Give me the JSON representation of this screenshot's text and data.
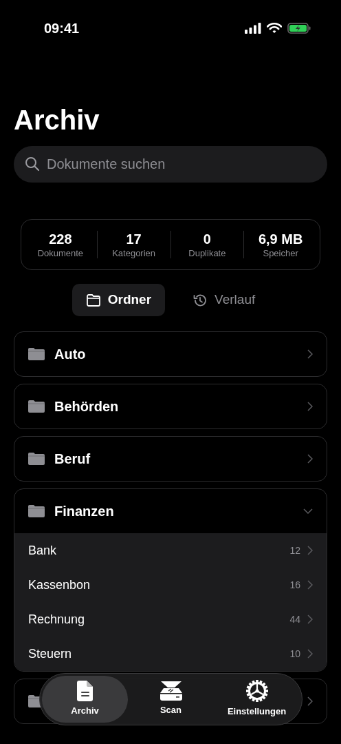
{
  "status_bar": {
    "time": "09:41"
  },
  "title": "Archiv",
  "search": {
    "placeholder": "Dokumente suchen"
  },
  "stats": [
    {
      "value": "228",
      "label": "Dokumente"
    },
    {
      "value": "17",
      "label": "Kategorien"
    },
    {
      "value": "0",
      "label": "Duplikate"
    },
    {
      "value": "6,9 MB",
      "label": "Speicher"
    }
  ],
  "view_tabs": [
    {
      "label": "Ordner",
      "kind": "folder",
      "selected": true
    },
    {
      "label": "Verlauf",
      "kind": "history",
      "selected": false
    }
  ],
  "folders": [
    {
      "name": "Auto",
      "expanded": false
    },
    {
      "name": "Behörden",
      "expanded": false
    },
    {
      "name": "Beruf",
      "expanded": false
    },
    {
      "name": "Finanzen",
      "expanded": true,
      "children": [
        {
          "name": "Bank",
          "count": "12"
        },
        {
          "name": "Kassenbon",
          "count": "16"
        },
        {
          "name": "Rechnung",
          "count": "44"
        },
        {
          "name": "Steuern",
          "count": "10"
        }
      ]
    },
    {
      "expanded": false
    }
  ],
  "tab_bar": [
    {
      "label": "Archiv",
      "kind": "document",
      "selected": true
    },
    {
      "label": "Scan",
      "kind": "scanner",
      "selected": false
    },
    {
      "label": "Einstellungen",
      "kind": "gear",
      "selected": false
    }
  ]
}
